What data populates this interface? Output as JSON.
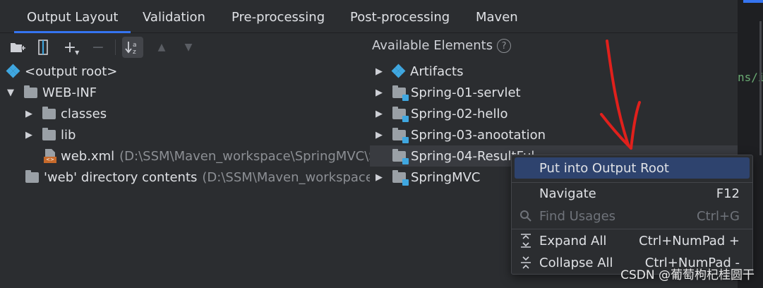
{
  "tabs": [
    {
      "label": "Output Layout",
      "active": true
    },
    {
      "label": "Validation"
    },
    {
      "label": "Pre-processing"
    },
    {
      "label": "Post-processing"
    },
    {
      "label": "Maven"
    }
  ],
  "toolbar": {
    "new_dir": "folder-plus-icon",
    "archive": "archive-icon",
    "add": "+",
    "remove": "−",
    "sort": "↓a z",
    "up": "▲",
    "down": "▼"
  },
  "left_tree": {
    "root": "<output root>",
    "webinf": "WEB-INF",
    "classes": "classes",
    "lib": "lib",
    "webxml": "web.xml",
    "webxml_path": "(D:\\SSM\\Maven_workspace\\SpringMVC\\Sp",
    "webdir": "'web' directory contents",
    "webdir_path": "(D:\\SSM\\Maven_workspace\\S"
  },
  "available": {
    "title": "Available Elements",
    "help": "?",
    "items": [
      {
        "label": "Artifacts"
      },
      {
        "label": "Spring-01-servlet"
      },
      {
        "label": "Spring-02-hello"
      },
      {
        "label": "Spring-03-anootation"
      },
      {
        "label": "Spring-04-ResultFul"
      },
      {
        "label": "SpringMVC"
      }
    ]
  },
  "menu": {
    "items": [
      {
        "label": "Put into Output Root",
        "key": ""
      },
      {
        "label": "Navigate",
        "key": "F12"
      },
      {
        "label": "Find Usages",
        "key": "Ctrl+G"
      },
      {
        "label": "Expand All",
        "key": "Ctrl+NumPad +"
      },
      {
        "label": "Collapse All",
        "key": "Ctrl+NumPad -"
      }
    ]
  },
  "editor": {
    "code": "ns/i"
  },
  "watermark": "CSDN @葡萄枸杞桂圆干",
  "colors": {
    "accent": "#3574f0",
    "module": "#3fa7e0",
    "annotation": "#e0201c"
  }
}
